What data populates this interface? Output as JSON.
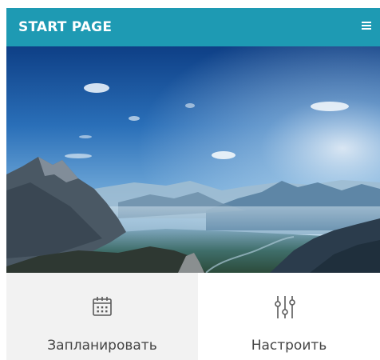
{
  "header": {
    "title": "START PAGE",
    "menu_icon": "hamburger-menu-icon",
    "background_color": "#1e9ab3"
  },
  "hero": {
    "image": "mountain-landscape-photo"
  },
  "actions": [
    {
      "label": "Запланировать",
      "icon": "calendar-icon"
    },
    {
      "label": "Настроить",
      "icon": "sliders-icon"
    }
  ]
}
